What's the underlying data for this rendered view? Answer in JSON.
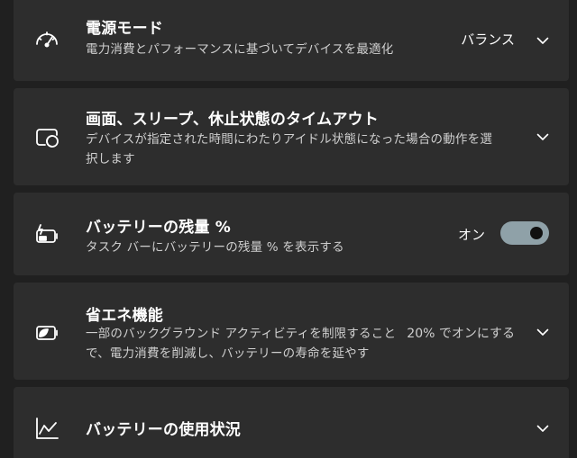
{
  "settings": [
    {
      "title": "電源モード",
      "description": "電力消費とパフォーマンスに基づいてデバイスを最適化",
      "value": "バランス",
      "icon": "gauge-icon",
      "control": "dropdown"
    },
    {
      "title": "画面、スリープ、休止状態のタイムアウト",
      "description_line1": "デバイスが指定された時間にわたりアイドル状態になった場合の動作を選",
      "description_line2": "択します",
      "icon": "screen-sleep-icon",
      "control": "expand"
    },
    {
      "title": "バッテリーの残量 %",
      "description": "タスク バーにバッテリーの残量 % を表示する",
      "value": "オン",
      "icon": "battery-charging-icon",
      "control": "toggle",
      "toggle_on": true
    },
    {
      "title": "省エネ機能",
      "description_line1": "一部のバックグラウンド アクティビティを制限することで、電力消費を削減し、バッテリーの寿命を延やす",
      "description_line1a": "一部のバックグラウンド アクティビティを制限すること",
      "description_line2": "で、電力消費を削減し、バッテリーの寿命を延やす",
      "value": "20% でオンにする",
      "icon": "battery-saver-icon",
      "control": "dropdown"
    },
    {
      "title": "バッテリーの使用状況",
      "icon": "usage-chart-icon",
      "control": "expand"
    }
  ],
  "colors": {
    "background": "#202020",
    "card": "#2d2d2d",
    "text": "#ffffff",
    "secondary_text": "#cfcfcf",
    "toggle_track": "#8fa1a8",
    "toggle_knob": "#111111"
  }
}
